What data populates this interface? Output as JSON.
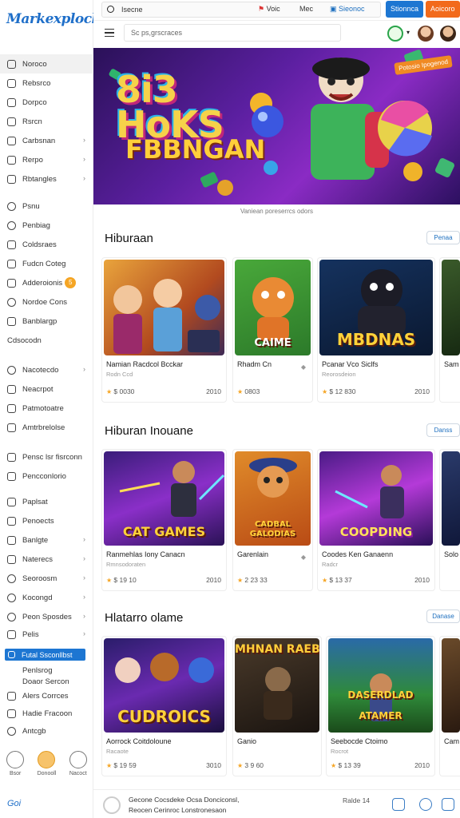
{
  "app": {
    "logo": "Markexplocl"
  },
  "topbar": {
    "search_value": "Isecne",
    "link1": "Voic",
    "link2": "Mec",
    "link3": "Sieonoc",
    "button_blue": "Stionnca",
    "button_orange": "Aoicoro"
  },
  "subbar": {
    "search_placeholder": "Sc ps,grscraces"
  },
  "sidebar": {
    "group1": [
      {
        "label": "Noroco",
        "chev": false
      },
      {
        "label": "Rebsrco",
        "chev": false
      },
      {
        "label": "Dorpco",
        "chev": false
      },
      {
        "label": "Rsrcn",
        "chev": false
      },
      {
        "label": "Carbsnan",
        "chev": true
      },
      {
        "label": "Rerpo",
        "chev": true
      },
      {
        "label": "Rbtangles",
        "chev": true
      }
    ],
    "group2": [
      {
        "label": "Psnu"
      },
      {
        "label": "Penbiag"
      },
      {
        "label": "Coldsraes"
      },
      {
        "label": "Fudcn Coteg"
      },
      {
        "label": "Adderoionis",
        "badge": "5"
      },
      {
        "label": "Nordoe Cons"
      },
      {
        "label": "Banblargp"
      },
      {
        "label": "Cdsocodn"
      }
    ],
    "group3": [
      {
        "label": "Nacotecdo",
        "chev": true
      },
      {
        "label": "Neacrpot",
        "chev": false
      },
      {
        "label": "Patmotoatre",
        "chev": false
      },
      {
        "label": "Amtrbrelolse",
        "chev": false
      }
    ],
    "group4": [
      {
        "label": "Pensc lsr fisrconn"
      },
      {
        "label": "Pencconlorio"
      }
    ],
    "group5": [
      {
        "label": "Paplsat",
        "chev": false
      },
      {
        "label": "Penoects",
        "chev": false
      },
      {
        "label": "Banlgte",
        "chev": true
      },
      {
        "label": "Naterecs",
        "chev": true
      },
      {
        "label": "Seoroosm",
        "chev": true
      },
      {
        "label": "Kocongd",
        "chev": true
      },
      {
        "label": "Peon Sposdes",
        "chev": true
      }
    ],
    "group6_label": "Pelis",
    "highlighted": "Futal Ssconllbst",
    "sub_items": [
      "Penlsrog",
      "Doaor Sercon",
      "Alers Corrces",
      "Hadie Fracoon",
      "Antcgb"
    ],
    "bottom": [
      "Bsor",
      "Donooll",
      "Nacoct"
    ],
    "footer_label": "Goi"
  },
  "hero": {
    "title_line1": "8i3",
    "title_line2": "HoKS",
    "subtitle": "FBBNGAN",
    "badge": "Potosio Ipogenod",
    "caption": "Vaniean poreserrcs odors"
  },
  "sections": [
    {
      "title": "Hiburaan",
      "button": "Penaa",
      "cards": [
        {
          "name": "Namian Racdcol Bcckar",
          "meta": "Rodn Ccd",
          "price": "$ 0030",
          "right": "2010",
          "art": ""
        },
        {
          "name": "Rhadm Cn",
          "meta": "",
          "price": "0803",
          "right": "",
          "art": "CAIME"
        },
        {
          "name": "Pcanar Vco Siclfs",
          "meta": "Reorosdeion",
          "price": "$ 12 830",
          "right": "2010",
          "art": "MBDNAS"
        },
        {
          "name": "Sam",
          "meta": "",
          "price": "",
          "right": "",
          "art": ""
        }
      ]
    },
    {
      "title": "Hiburan Inouane",
      "button": "Danss",
      "cards": [
        {
          "name": "Ranmehlas Iony Canacn",
          "meta": "Rmnsodoraten",
          "price": "$ 19 10",
          "right": "2010",
          "art": "CAT GAMES"
        },
        {
          "name": "Garenlain",
          "meta": "",
          "price": "2 23 33",
          "right": "",
          "art": "CADBAL GALODIAS"
        },
        {
          "name": "Coodes Ken Ganaenn",
          "meta": "Radcr",
          "price": "$ 13 37",
          "right": "2010",
          "art": "COOPDING"
        },
        {
          "name": "Solo",
          "meta": "",
          "price": "",
          "right": "",
          "art": ""
        }
      ]
    },
    {
      "title": "Hlatarro olame",
      "button": "Danase",
      "cards": [
        {
          "name": "Aorrock Coitdoloune",
          "meta": "Racaote",
          "price": "$ 19 59",
          "right": "3010",
          "art": "CUDROICS"
        },
        {
          "name": "Ganio",
          "meta": "",
          "price": "3 9 60",
          "right": "",
          "art": "MHNAN RAEBIAS"
        },
        {
          "name": "Seebocde Ctoimo",
          "meta": "Rocrot",
          "price": "$ 13 39",
          "right": "2010",
          "art": "DASERDLAD ATAMER"
        },
        {
          "name": "Cam",
          "meta": "",
          "price": "",
          "right": "",
          "art": ""
        }
      ]
    }
  ],
  "footer": {
    "line1": "Gecone Cocsdeke Ocsa Donciconsl,",
    "line2": "Reocen Cerinroc Lonstronesaon",
    "right": "Ralde 14"
  }
}
